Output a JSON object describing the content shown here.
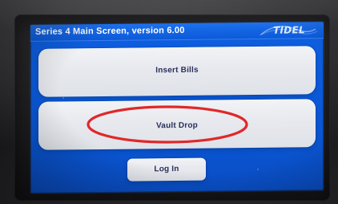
{
  "header": {
    "title": "Series 4 Main Screen, version 6.00",
    "brand_logo_text": "TIDEL",
    "brand_logo_icon": "brand-wordmark"
  },
  "main": {
    "buttons": [
      {
        "id": "insert-bills",
        "label": "Insert Bills"
      },
      {
        "id": "vault-drop",
        "label": "Vault Drop"
      },
      {
        "id": "log-in",
        "label": "Log In"
      }
    ]
  },
  "annotation": {
    "highlight_color": "#e0282a"
  },
  "colors": {
    "screen_blue": "#0a57d6",
    "button_text": "#2a2f5a"
  }
}
